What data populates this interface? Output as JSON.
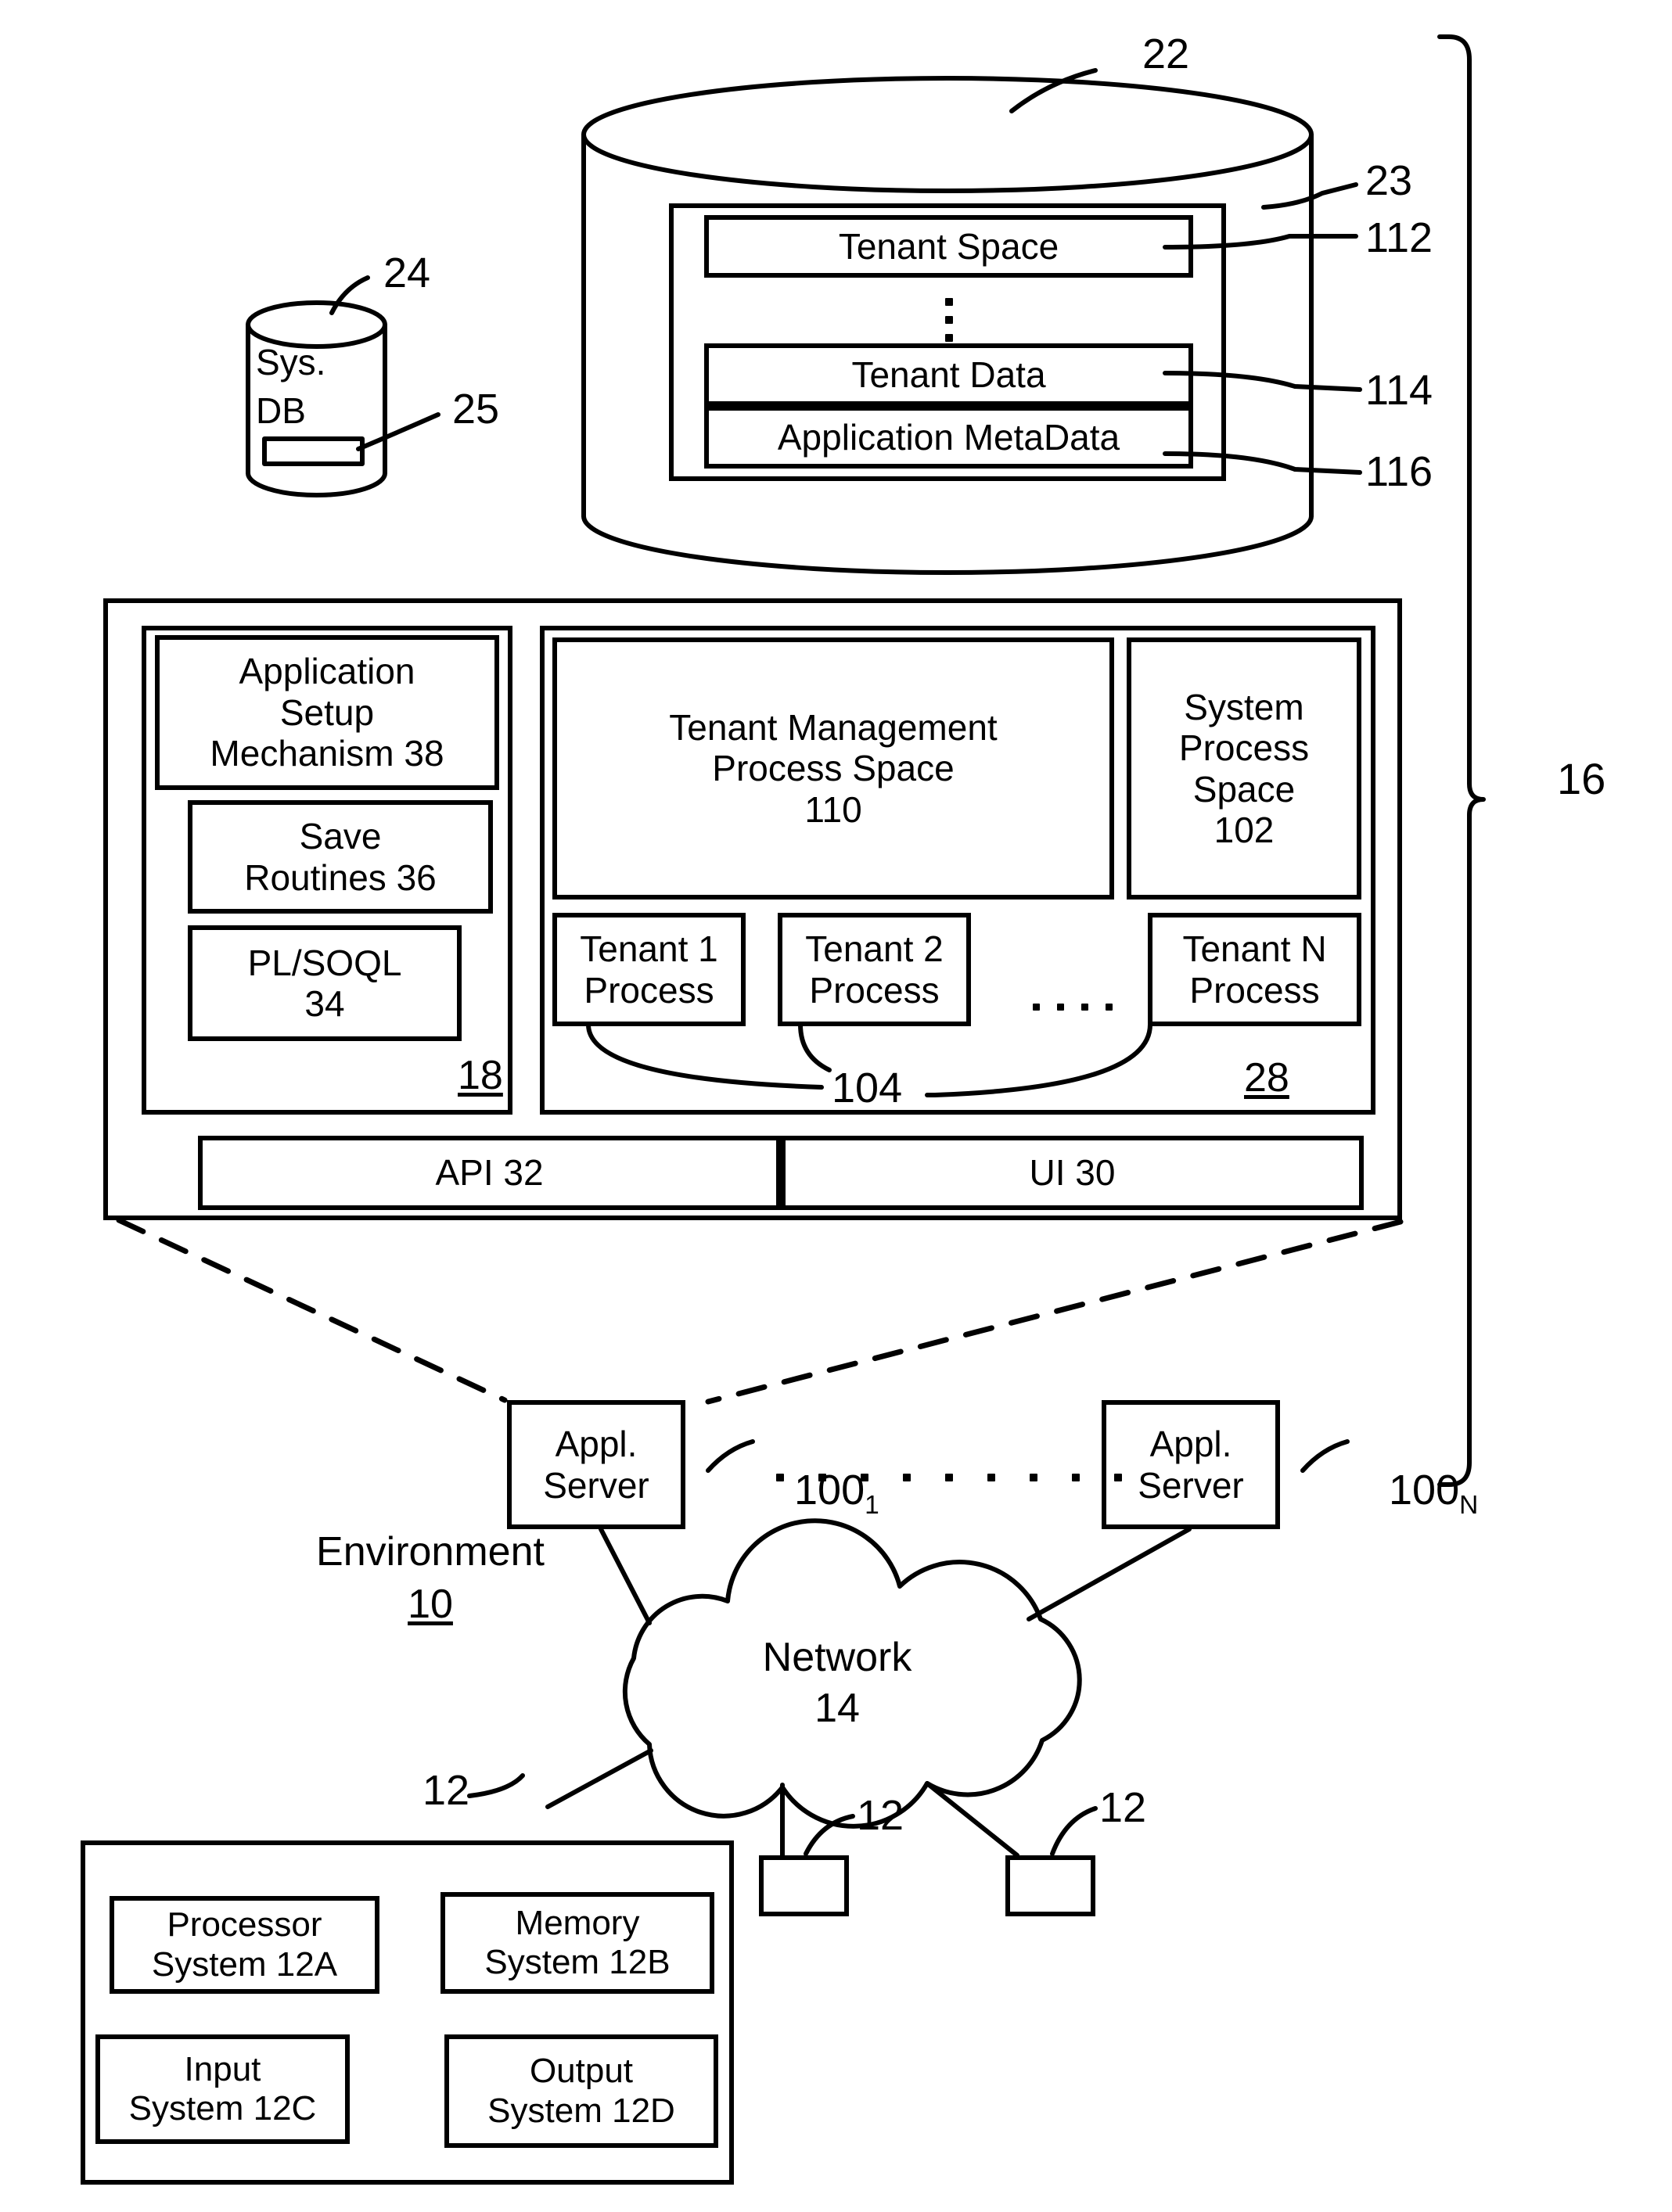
{
  "figure": {
    "title": "Multi-tenant on-demand database system environment block diagram",
    "background": "#ffffff",
    "ink": "#000000"
  },
  "tenant_db": {
    "ref": "22",
    "inner_ref": "23",
    "blocks": [
      {
        "label": "Tenant Space",
        "ref": "112"
      },
      {
        "label": "Tenant Data",
        "ref": "114"
      },
      {
        "label": "Application MetaData",
        "ref": "116"
      }
    ],
    "vertical_ellipsis": "⋮"
  },
  "sys_db": {
    "label_line1": "Sys.",
    "label_line2": "DB",
    "ref_cylinder": "24",
    "ref_slot": "25"
  },
  "system": {
    "ref": "16",
    "left_panel": {
      "ref": "18",
      "blocks": [
        {
          "label": "Application\nSetup\nMechanism 38"
        },
        {
          "label": "Save\nRoutines 36"
        },
        {
          "label": "PL/SOQL\n34"
        }
      ]
    },
    "right_panel": {
      "ref": "28",
      "tenant_management": "Tenant Management\nProcess Space\n110",
      "system_process": "System\nProcess\nSpace\n102",
      "tenant_processes": [
        "Tenant 1\nProcess",
        "Tenant 2\nProcess",
        "Tenant N\nProcess"
      ],
      "process_ref": "104",
      "process_ellipsis": "...."
    },
    "bottom_bar": [
      {
        "label": "API 32"
      },
      {
        "label": "UI 30"
      }
    ]
  },
  "app_servers": [
    {
      "label": "Appl.\nServer",
      "ref": "100",
      "ref_sub": "1"
    },
    {
      "label": "Appl.\nServer",
      "ref": "100",
      "ref_sub": "N"
    }
  ],
  "environment": {
    "label": "Environment",
    "ref": "10"
  },
  "network": {
    "label": "Network",
    "ref": "14"
  },
  "user_system": {
    "ref": "12",
    "blocks": [
      "Processor\nSystem 12A",
      "Memory\nSystem 12B",
      "Input\nSystem 12C",
      "Output\nSystem 12D"
    ]
  },
  "user_terminals": [
    {
      "ref": "12"
    },
    {
      "ref": "12"
    }
  ]
}
